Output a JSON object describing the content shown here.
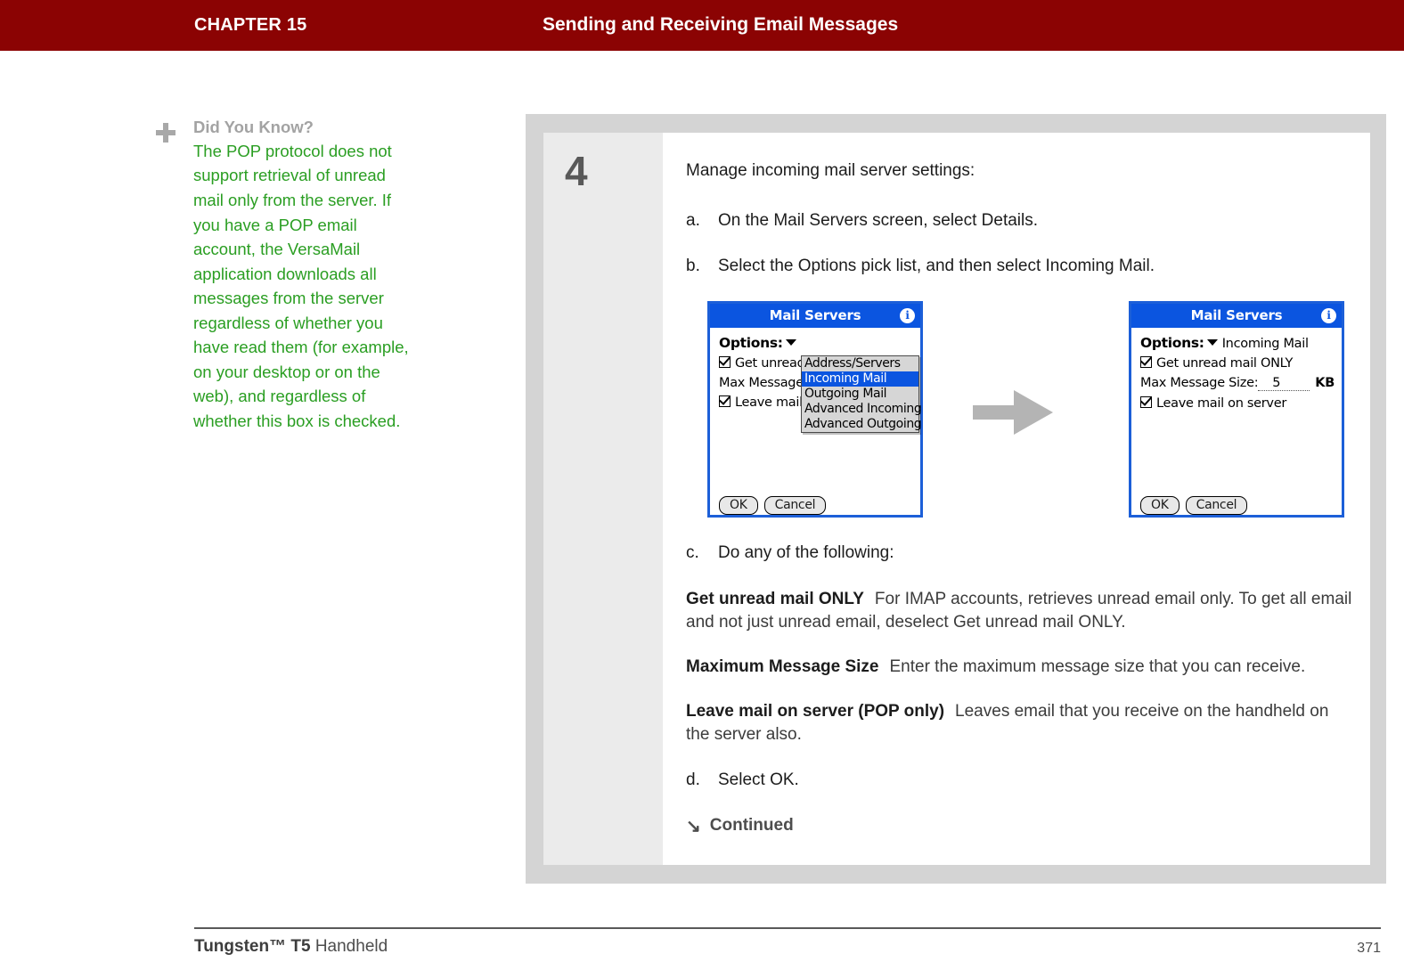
{
  "header": {
    "chapter_label": "CHAPTER 15",
    "title": "Sending and Receiving Email Messages",
    "background_color": "#8b0303",
    "text_color": "#ffffff"
  },
  "side_note": {
    "icon": "plus-icon",
    "heading": "Did You Know?",
    "body": "The POP protocol does not support retrieval of unread mail only from the server. If you have a POP email account, the VersaMail application downloads all messages from the server regardless of whether you have read them (for example, on your desktop or on the web), and regardless of whether this box is checked.",
    "heading_color": "#a3a3a3",
    "body_color": "#2a9e22"
  },
  "step": {
    "number": "4",
    "lead": "Manage incoming mail server settings:",
    "substeps": [
      {
        "marker": "a.",
        "text": "On the Mail Servers screen, select Details."
      },
      {
        "marker": "b.",
        "text": "Select the Options pick list, and then select Incoming Mail."
      },
      {
        "marker": "c.",
        "text": "Do any of the following:"
      },
      {
        "marker": "d.",
        "text": "Select OK."
      }
    ],
    "definitions": [
      {
        "term": "Get unread mail ONLY",
        "description": "For IMAP accounts, retrieves unread email only. To get all email and not just unread email, deselect Get unread mail ONLY."
      },
      {
        "term": "Maximum Message Size",
        "description": "Enter the maximum message size that you can receive."
      },
      {
        "term": "Leave mail on server (POP only)",
        "description": "Leaves email that you receive on the handheld on the server also."
      }
    ],
    "continued_label": "Continued",
    "continued_icon": "arrow-down-right-icon"
  },
  "devices": {
    "arrow_icon": "arrow-right-icon",
    "arrow_color": "#b4b4b4",
    "titlebar_color": "#0b55e0",
    "screen_1": {
      "title": "Mail Servers",
      "info_icon": "info-icon",
      "options_label": "Options:",
      "options_caret": "chevron-down-icon",
      "rows": [
        {
          "type": "checkbox",
          "checked": true,
          "label": "Get unread mail ONLY"
        },
        {
          "type": "text",
          "label": "Max Message Size:"
        },
        {
          "type": "checkbox",
          "checked": true,
          "label": "Leave mail on server"
        }
      ],
      "picklist": {
        "items": [
          "Address/Servers",
          "Incoming Mail",
          "Outgoing Mail",
          "Advanced Incoming",
          "Advanced Outgoing"
        ],
        "selected": "Incoming Mail"
      },
      "buttons": [
        "OK",
        "Cancel"
      ]
    },
    "screen_2": {
      "title": "Mail Servers",
      "info_icon": "info-icon",
      "options_label": "Options:",
      "options_caret": "chevron-down-icon",
      "options_value": "Incoming Mail",
      "checkbox_1_label": "Get unread mail ONLY",
      "checkbox_1_checked": true,
      "size_label": "Max Message Size:",
      "size_value": "5",
      "size_unit": "KB",
      "checkbox_2_label": "Leave mail on server",
      "checkbox_2_checked": true,
      "buttons": [
        "OK",
        "Cancel"
      ]
    }
  },
  "footer": {
    "brand": "Tungsten™ T5",
    "product": " Handheld",
    "page_number": "371"
  }
}
